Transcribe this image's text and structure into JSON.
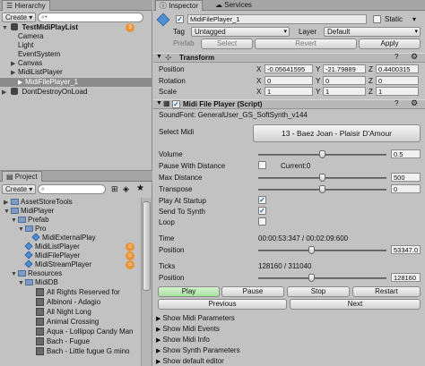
{
  "hierarchy": {
    "tab": "Hierarchy",
    "create": "Create",
    "search_placeholder": "Q▾All",
    "scene": "TestMidiPlayList",
    "scene_count": "3",
    "items": [
      "Camera",
      "Light",
      "EventSystem",
      "Canvas",
      "MidiListPlayer",
      "MidiFilePlayer_1",
      "DontDestroyOnLoad"
    ]
  },
  "project": {
    "tab": "Project",
    "create": "Create",
    "tree": [
      {
        "label": "AssetStoreTools"
      },
      {
        "label": "MidiPlayer"
      },
      {
        "label": "Prefab"
      },
      {
        "label": "Pro"
      },
      {
        "label": "MidiExternalPlay"
      },
      {
        "label": "MidiListPlayer"
      },
      {
        "label": "MidiFilePlayer"
      },
      {
        "label": "MidiStreamPlayer"
      },
      {
        "label": "Resources"
      },
      {
        "label": "MidiDB"
      },
      {
        "label": "All Rights Reserved for"
      },
      {
        "label": "Albinoni - Adagio"
      },
      {
        "label": "All Night Long"
      },
      {
        "label": "Animal Crossing"
      },
      {
        "label": "Aqua - Lollipop Candy Man"
      },
      {
        "label": "Bach - Fugue"
      },
      {
        "label": "Bach - Little fugue G mino"
      }
    ]
  },
  "inspector": {
    "tab": "Inspector",
    "tab2": "Services",
    "object_name": "MidiFilePlayer_1",
    "static_label": "Static",
    "tag_label": "Tag",
    "tag_value": "Untagged",
    "layer_label": "Layer",
    "layer_value": "Default",
    "prefab_label": "Prefab",
    "select": "Select",
    "revert": "Revert",
    "apply": "Apply",
    "transform": {
      "title": "Transform",
      "position_label": "Position",
      "rotation_label": "Rotation",
      "scale_label": "Scale",
      "position": [
        "-0.05641595",
        "-21.79889",
        "0.4400315"
      ],
      "rotation": [
        "0",
        "0",
        "0"
      ],
      "scale": [
        "1",
        "1",
        "1"
      ]
    },
    "script": {
      "title": "Midi File Player (Script)",
      "soundfont": "SoundFont: GeneralUser_GS_SoftSynth_v144",
      "select_midi_label": "Select Midi",
      "select_midi_value": "13 - Baez Joan - Plaisir D'Amour",
      "volume_label": "Volume",
      "volume_value": "0.5",
      "pause_label": "Pause With Distance",
      "current_label": "Current:0",
      "max_distance_label": "Max Distance",
      "max_distance_value": "500",
      "transpose_label": "Transpose",
      "transpose_value": "0",
      "play_startup_label": "Play At Startup",
      "send_synth_label": "Send To Synth",
      "loop_label": "Loop",
      "time_label": "Time",
      "time_value": "00:00:53:347 / 00:02:09:600",
      "time_position_label": "Position",
      "time_position_value": "53347.0",
      "ticks_label": "Ticks",
      "ticks_value": "128160 / 311040",
      "ticks_position_label": "Position",
      "ticks_position_value": "128160",
      "buttons": {
        "play": "Play",
        "pause": "Pause",
        "stop": "Stop",
        "restart": "Restart",
        "previous": "Previous",
        "next": "Next"
      },
      "foldouts": [
        "Show Midi Parameters",
        "Show Midi Events",
        "Show Midi Info",
        "Show Synth Parameters",
        "Show default editor"
      ]
    }
  },
  "state": {
    "volume": 0.5,
    "max_distance_fraction": 0.5,
    "transpose": 0,
    "time_fraction": 0.41,
    "ticks_fraction": 0.41,
    "play_at_startup": true,
    "send_to_synth": true,
    "loop": false,
    "pause_with_distance": false,
    "static": false
  },
  "colors": {
    "panel": "#c2c2c2",
    "selection": "#8c8c8c",
    "play_active": "#a8e0a0"
  }
}
